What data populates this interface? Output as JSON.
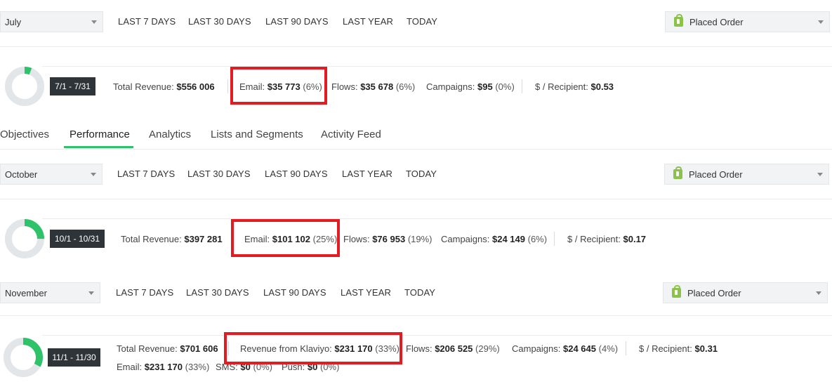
{
  "range_buttons": [
    "LAST 7 DAYS",
    "LAST 30 DAYS",
    "LAST 90 DAYS",
    "LAST YEAR",
    "TODAY"
  ],
  "metric_select": "Placed Order",
  "tabs": [
    "Objectives",
    "Performance",
    "Analytics",
    "Lists and Segments",
    "Activity Feed"
  ],
  "active_tab": "Performance",
  "colors": {
    "accent_green": "#2ec26a",
    "highlight_red": "#e31b23",
    "badge_dark": "#2f3439"
  },
  "july": {
    "month": "July",
    "date_range": "7/1 - 7/31",
    "total_revenue_label": "Total Revenue:",
    "total_revenue": "$556 006",
    "email_label": "Email:",
    "email_value": "$35 773",
    "email_pct": "(6%)",
    "flows_label": "Flows:",
    "flows_value": "$35 678",
    "flows_pct": "(6%)",
    "campaigns_label": "Campaigns:",
    "campaigns_value": "$95",
    "campaigns_pct": "(0%)",
    "recipient_label": "$ / Recipient:",
    "recipient_value": "$0.53",
    "share": 0.06
  },
  "october": {
    "month": "October",
    "date_range": "10/1 - 10/31",
    "total_revenue_label": "Total Revenue:",
    "total_revenue": "$397 281",
    "email_label": "Email:",
    "email_value": "$101 102",
    "email_pct": "(25%)",
    "flows_label": "Flows:",
    "flows_value": "$76 953",
    "flows_pct": "(19%)",
    "campaigns_label": "Campaigns:",
    "campaigns_value": "$24 149",
    "campaigns_pct": "(6%)",
    "recipient_label": "$ / Recipient:",
    "recipient_value": "$0.17",
    "share": 0.25
  },
  "november": {
    "month": "November",
    "date_range": "11/1 - 11/30",
    "total_revenue_label": "Total Revenue:",
    "total_revenue": "$701 606",
    "klaviyo_label": "Revenue from Klaviyo:",
    "klaviyo_value": "$231 170",
    "klaviyo_pct": "(33%)",
    "flows_label": "Flows:",
    "flows_value": "$206 525",
    "flows_pct": "(29%)",
    "campaigns_label": "Campaigns:",
    "campaigns_value": "$24 645",
    "campaigns_pct": "(4%)",
    "recipient_label": "$ / Recipient:",
    "recipient_value": "$0.31",
    "email_label": "Email:",
    "email_value": "$231 170",
    "email_pct": "(33%)",
    "sms_label": "SMS:",
    "sms_value": "$0",
    "sms_pct": "(0%)",
    "push_label": "Push:",
    "push_value": "$0",
    "push_pct": "(0%)",
    "share": 0.33
  }
}
